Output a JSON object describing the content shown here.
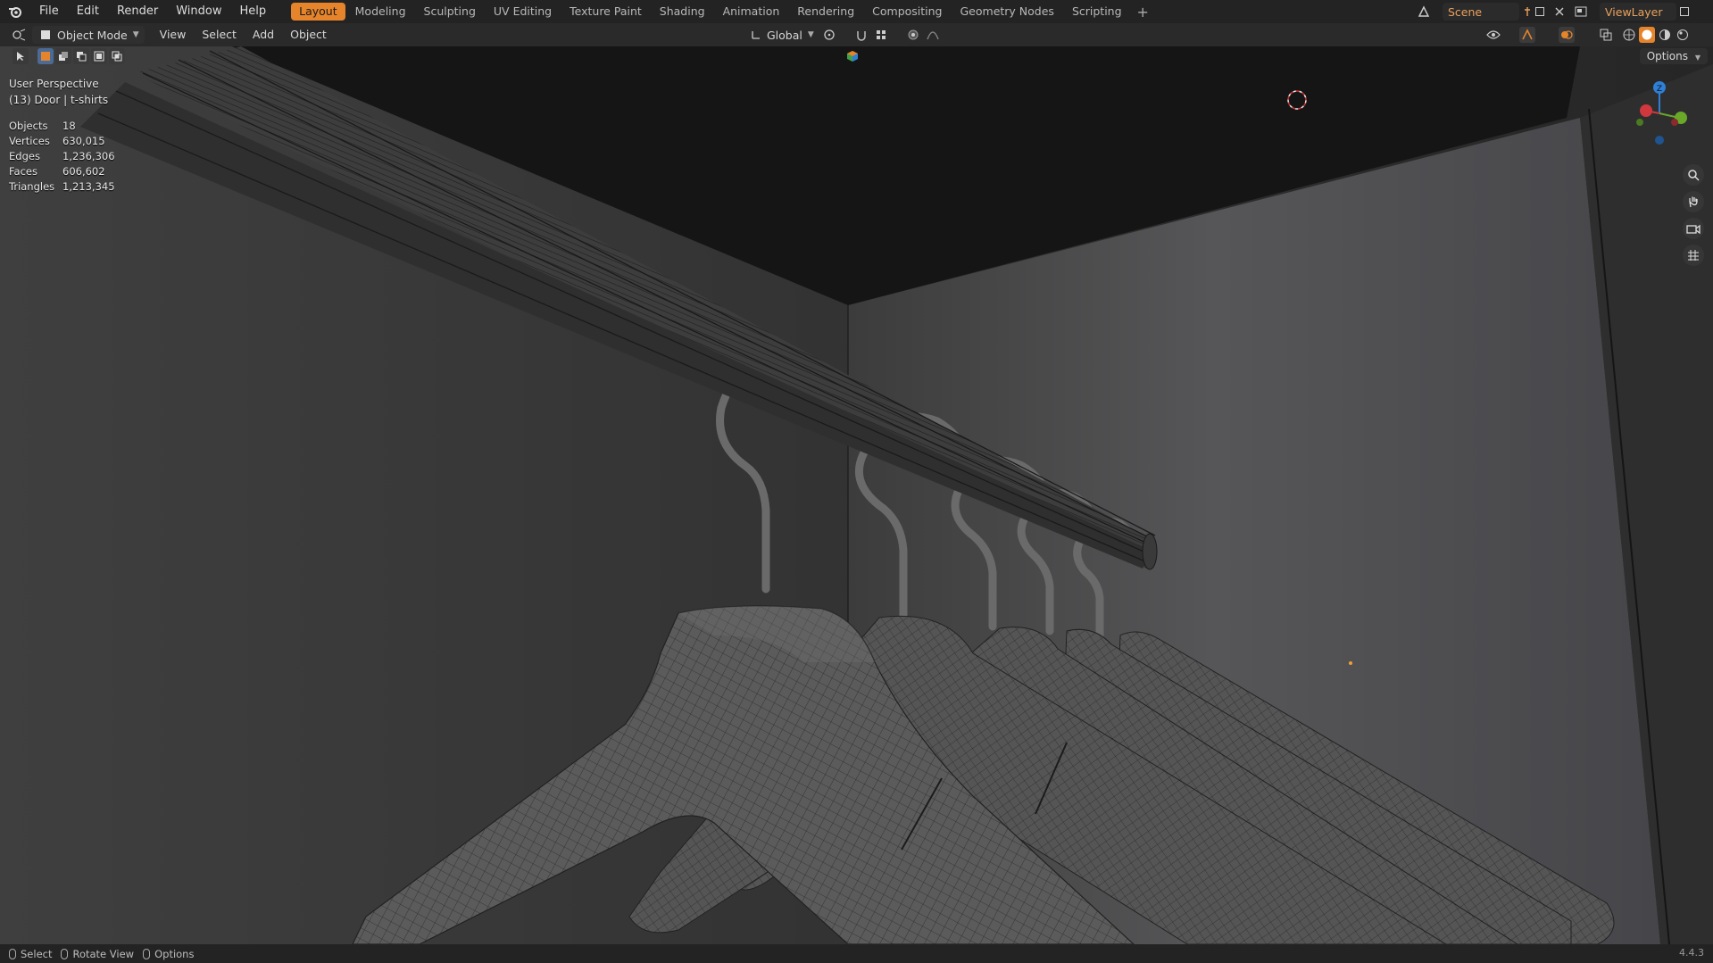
{
  "menu": {
    "items": [
      "File",
      "Edit",
      "Render",
      "Window",
      "Help"
    ]
  },
  "workspaces": {
    "tabs": [
      "Layout",
      "Modeling",
      "Sculpting",
      "UV Editing",
      "Texture Paint",
      "Shading",
      "Animation",
      "Rendering",
      "Compositing",
      "Geometry Nodes",
      "Scripting"
    ],
    "active": "Layout"
  },
  "scene": {
    "name": "Scene"
  },
  "view_layer": {
    "name": "ViewLayer"
  },
  "header": {
    "mode": "Object Mode",
    "menus": [
      "View",
      "Select",
      "Add",
      "Object"
    ],
    "transform_orientation": "Global",
    "options_label": "Options"
  },
  "viewport": {
    "perspective": "User Perspective",
    "object_info": "(13) Door | t-shirts",
    "stats": [
      {
        "key": "Objects",
        "value": "18"
      },
      {
        "key": "Vertices",
        "value": "630,015"
      },
      {
        "key": "Edges",
        "value": "1,236,306"
      },
      {
        "key": "Faces",
        "value": "606,602"
      },
      {
        "key": "Triangles",
        "value": "1,213,345"
      }
    ],
    "gizmo_axis_label": "Z"
  },
  "status": {
    "items": [
      "Select",
      "Rotate View",
      "Options"
    ],
    "version": "4.4.3"
  },
  "colors": {
    "accent": "#e5842b",
    "axis_x": "#d0383d",
    "axis_y": "#6aa82a",
    "axis_z": "#2e7fd6"
  }
}
